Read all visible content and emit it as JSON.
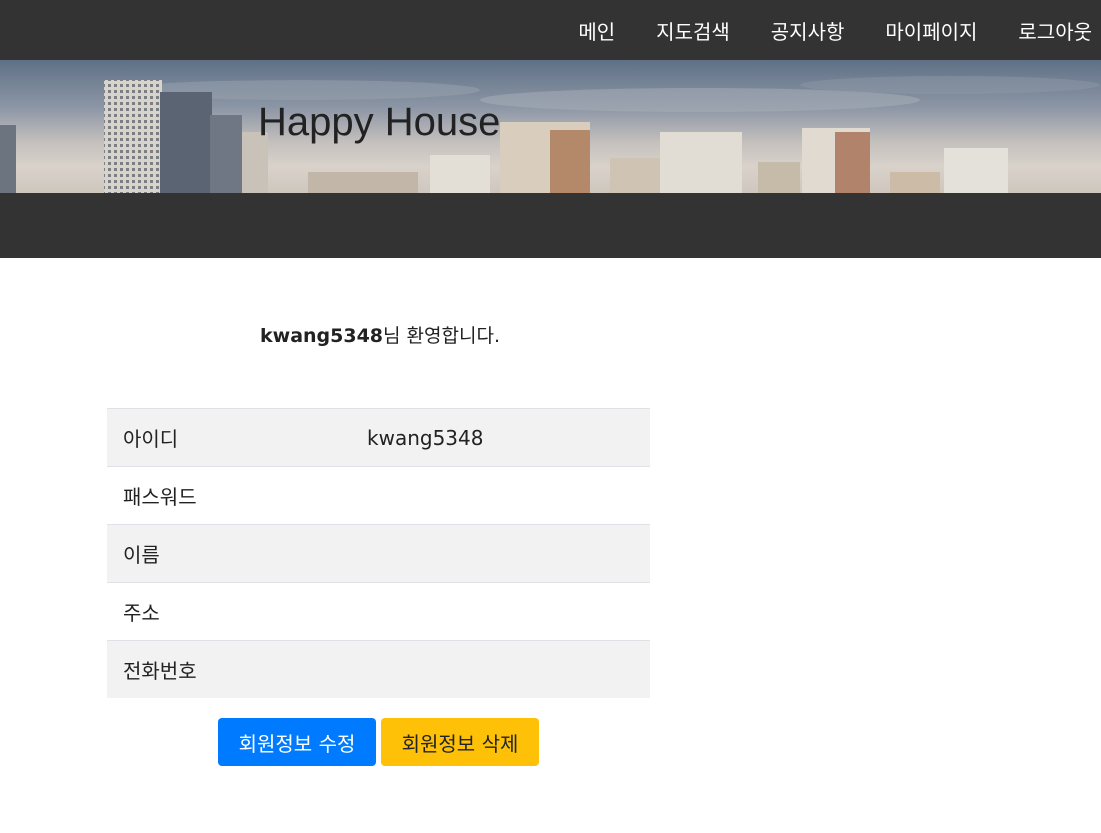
{
  "nav": {
    "items": [
      {
        "label": "메인"
      },
      {
        "label": "지도검색"
      },
      {
        "label": "공지사항"
      },
      {
        "label": "마이페이지"
      },
      {
        "label": "로그아웃"
      }
    ]
  },
  "hero": {
    "title": "Happy House"
  },
  "welcome": {
    "user_id": "kwang5348",
    "message": "님 환영합니다."
  },
  "profile": {
    "rows": [
      {
        "label": "아이디",
        "value": "kwang5348"
      },
      {
        "label": "패스워드",
        "value": ""
      },
      {
        "label": "이름",
        "value": ""
      },
      {
        "label": "주소",
        "value": ""
      },
      {
        "label": "전화번호",
        "value": ""
      }
    ]
  },
  "buttons": {
    "edit_label": "회원정보 수정",
    "delete_label": "회원정보 삭제"
  },
  "colors": {
    "nav_bg": "#333333",
    "primary": "#007bff",
    "warning": "#ffc107"
  }
}
